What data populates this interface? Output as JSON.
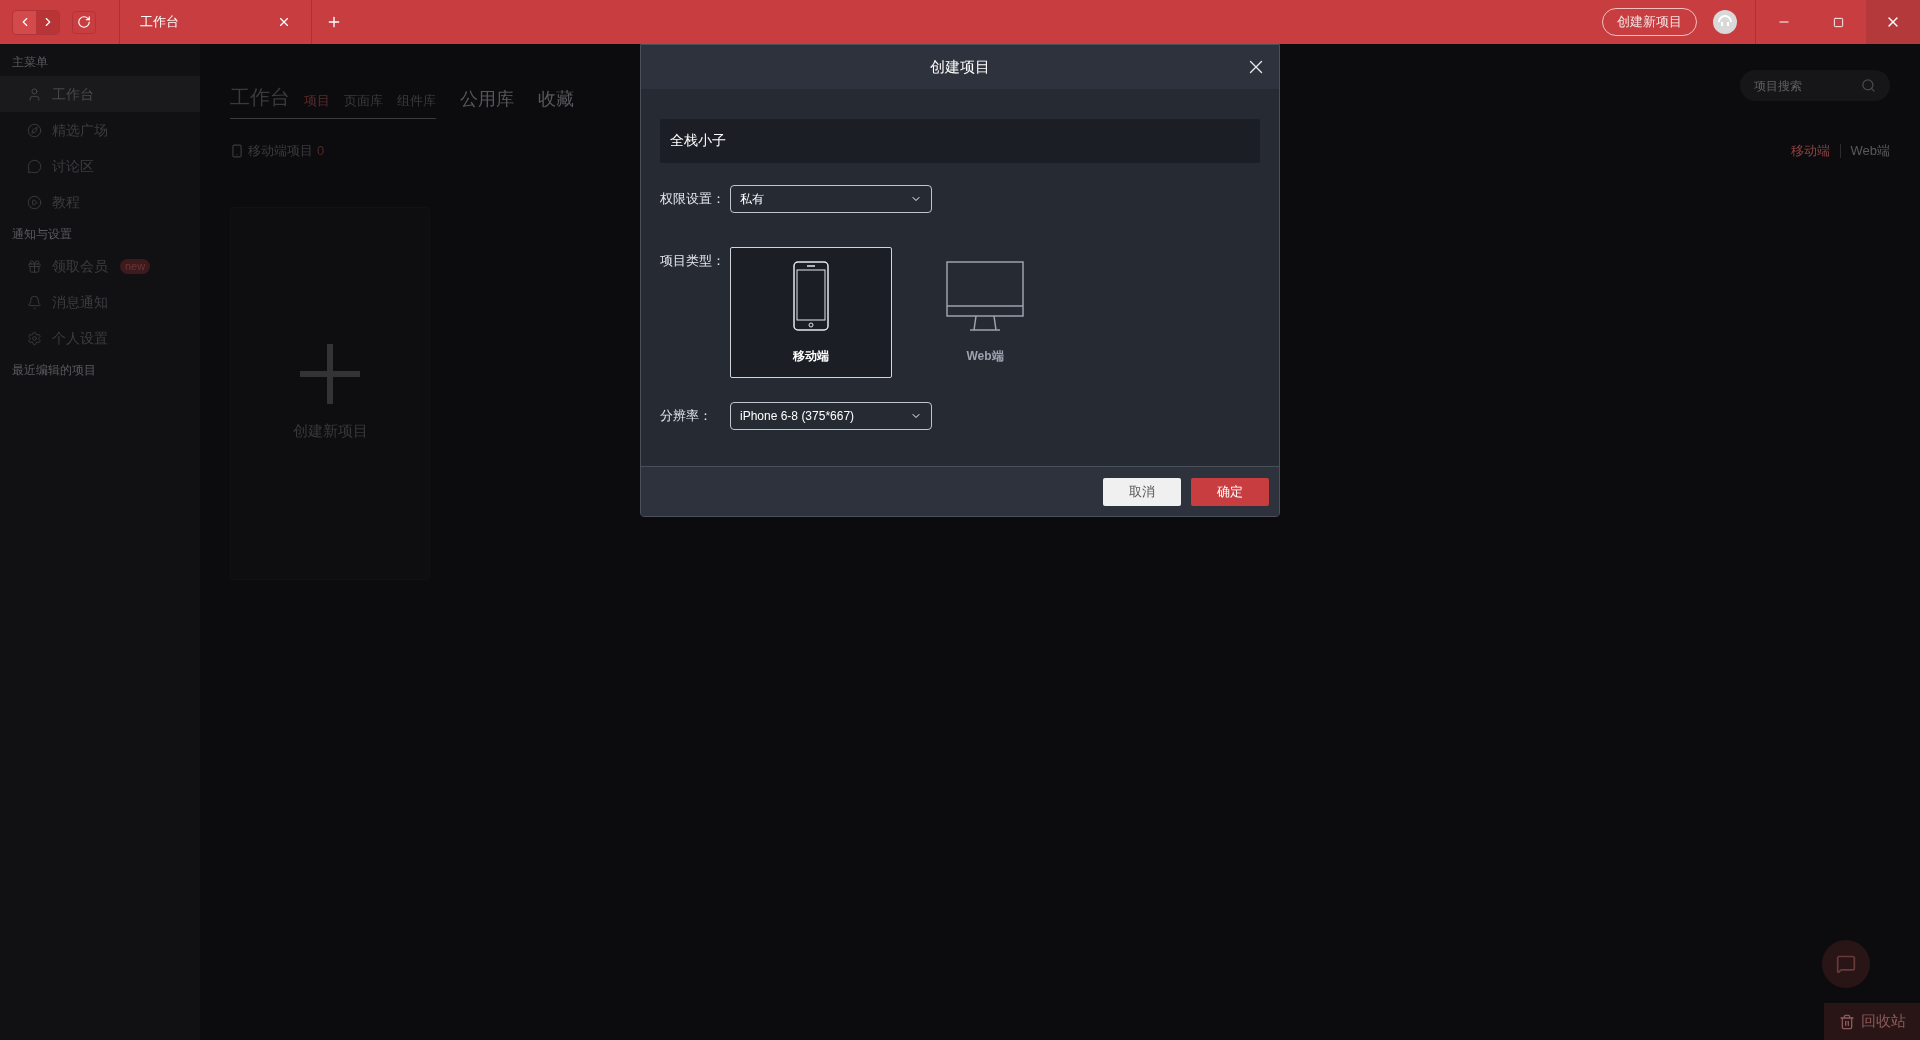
{
  "title_bar": {
    "tabs": [
      {
        "label": "工作台",
        "selected": true
      }
    ],
    "create_button": "创建新项目"
  },
  "sidebar": {
    "sections": [
      {
        "title": "主菜单",
        "items": [
          {
            "label": "工作台",
            "selected": true
          },
          {
            "label": "精选广场",
            "selected": false
          },
          {
            "label": "讨论区",
            "selected": false
          },
          {
            "label": "教程",
            "selected": false
          }
        ]
      },
      {
        "title": "通知与设置",
        "items": [
          {
            "label": "领取会员",
            "selected": false,
            "badge": "new"
          },
          {
            "label": "消息通知",
            "selected": false
          },
          {
            "label": "个人设置",
            "selected": false
          }
        ]
      },
      {
        "title": "最近编辑的项目"
      }
    ]
  },
  "main": {
    "tabs": [
      {
        "label": "工作台",
        "kind": "heading",
        "selected": false
      },
      {
        "label": "项目",
        "kind": "sub",
        "selected": true
      },
      {
        "label": "页面库",
        "kind": "sub",
        "selected": false
      },
      {
        "label": "组件库",
        "kind": "sub",
        "selected": false
      },
      {
        "label": "公用库",
        "kind": "main",
        "selected": false
      },
      {
        "label": "收藏",
        "kind": "main",
        "selected": false
      }
    ],
    "search": {
      "placeholder": "项目搜索"
    },
    "section": {
      "label": "移动端项目",
      "count": "0"
    },
    "platforms": [
      {
        "label": "移动端",
        "selected": true
      },
      {
        "label": "Web端",
        "selected": false
      }
    ],
    "create_card": "创建新项目",
    "recycle_button": "回收站"
  },
  "dialog": {
    "title": "创建项目",
    "name_value": "全栈小子",
    "permission": {
      "label": "权限设置：",
      "value": "私有"
    },
    "type": {
      "label": "项目类型：",
      "options": [
        {
          "label": "移动端",
          "kind": "mobile",
          "selected": true
        },
        {
          "label": "Web端",
          "kind": "web",
          "selected": false
        }
      ]
    },
    "resolution": {
      "label": "分辨率：",
      "value": "iPhone 6-8 (375*667)"
    },
    "buttons": {
      "cancel": "取消",
      "confirm": "确定"
    }
  }
}
